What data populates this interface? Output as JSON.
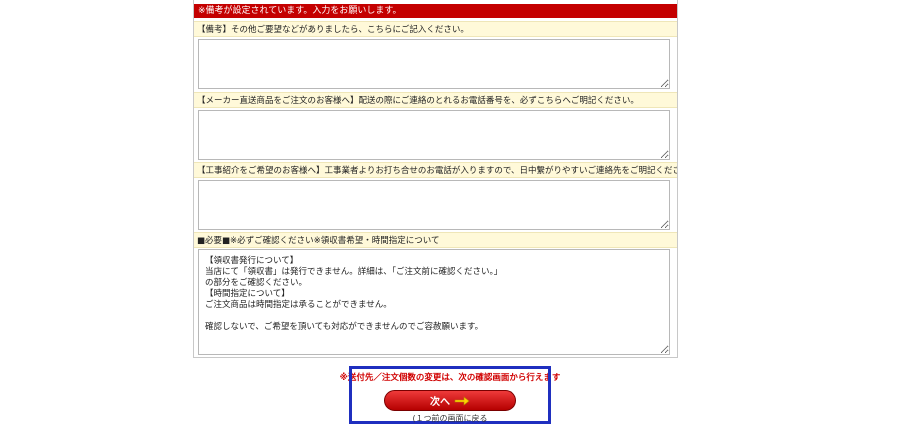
{
  "alert": {
    "text": "※備考が設定されています。入力をお願いします。"
  },
  "sections": [
    {
      "label": "【備考】その他ご要望などがありましたら、こちらにご記入ください。",
      "value": ""
    },
    {
      "label": "【メーカー直送商品をご注文のお客様へ】配送の際にご連絡のとれるお電話番号を、必ずこちらへご明記ください。",
      "value": ""
    },
    {
      "label": "【工事紹介をご希望のお客様へ】工事業者よりお打ち合せのお電話が入りますので、日中繋がりやすいご連絡先をご明記ください。",
      "value": ""
    }
  ],
  "notice": {
    "label": "■必要■※必ずご確認ください※領収書希望・時間指定について",
    "text": "【領収書発行について】\n当店にて「領収書」は発行できません。詳細は、「ご注文前に確認ください。」\nの部分をご確認ください。\n【時間指定について】\nご注文商品は時間指定は承ることができません。\n\n確認しないで、ご希望を頂いても対応ができませんのでご容赦願います。"
  },
  "footer": {
    "note": "※送付先／注文個数の変更は、次の確認画面から行えます",
    "next_label": "次へ",
    "back_label": "(１つ前の画面に戻る"
  },
  "colors": {
    "alert_bg": "#c40000",
    "label_bg": "#fff9d9",
    "frame": "#1f2fbf",
    "arrow": "#ffd400"
  },
  "icons": {
    "next_arrow": "right-arrow-icon"
  }
}
